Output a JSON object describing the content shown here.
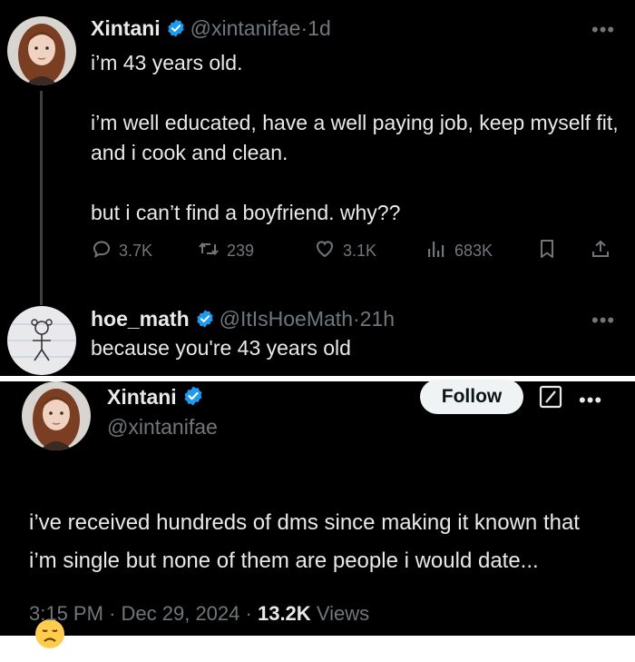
{
  "top_panel": {
    "tweet": {
      "display_name": "Xintani",
      "handle": "@xintanifae",
      "separator": "·",
      "time": "1d",
      "text": "i’m 43 years old.\n\ni’m well educated, have a well paying job, keep myself fit, and i cook and clean.\n\nbut i can’t find a boyfriend. why??",
      "actions": {
        "replies": "3.7K",
        "reposts": "239",
        "likes": "3.1K",
        "views": "683K"
      },
      "more_icon": "more-horizontal-icon"
    },
    "reply": {
      "display_name": "hoe_math",
      "handle": "@ItIsHoeMath",
      "separator": "·",
      "time": "21h",
      "text": "because you're 43 years old",
      "more_icon": "more-horizontal-icon"
    }
  },
  "bottom_panel": {
    "display_name": "Xintani",
    "handle": "@xintanifae",
    "follow_label": "Follow",
    "text": "i’ve received hundreds of dms since making it known that i’m single but none of them are people i would date...",
    "emoji": "😞",
    "timestamp": "3:15 PM",
    "date": "Dec 29, 2024",
    "separator": "·",
    "views_count": "13.2K",
    "views_label": "Views"
  },
  "colors": {
    "background": "#000000",
    "text": "#e7e9ea",
    "muted": "#71767b",
    "verified_blue": "#1d9bf0",
    "divider": "#ffffff"
  }
}
